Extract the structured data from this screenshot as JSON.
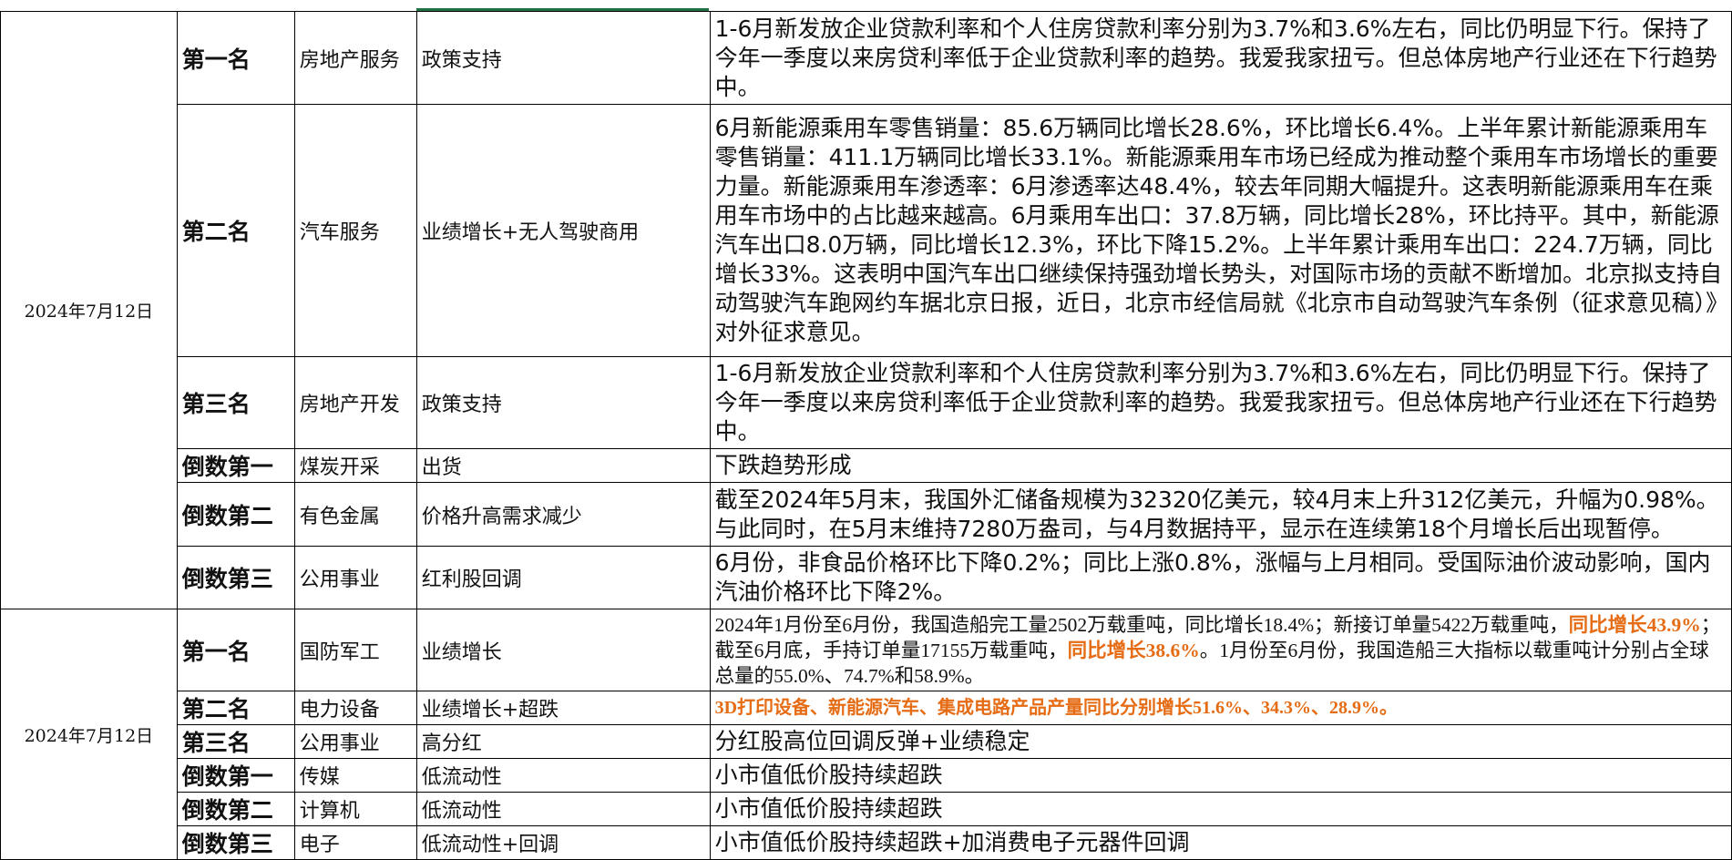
{
  "groups": [
    {
      "date": "2024年7月12日",
      "rows": [
        {
          "rank": "第一名",
          "industry": "房地产服务",
          "reason": "政策支持",
          "detail": "1-6月新发放企业贷款利率和个人住房贷款利率分别为3.7%和3.6%左右，同比仍明显下行。保持了今年一季度以来房贷利率低于企业贷款利率的趋势。我爱我家扭亏。但总体房地产行业还在下行趋势中。"
        },
        {
          "rank": "第二名",
          "industry": "汽车服务",
          "reason": "业绩增长+无人驾驶商用",
          "detail": "6月新能源乘用车零售销量：85.6万辆同比增长28.6%，环比增长6.4%。上半年累计新能源乘用车零售销量：411.1万辆同比增长33.1%。新能源乘用车市场已经成为推动整个乘用车市场增长的重要力量。新能源乘用车渗透率：6月渗透率达48.4%，较去年同期大幅提升。这表明新能源乘用车在乘用车市场中的占比越来越高。6月乘用车出口：37.8万辆，同比增长28%，环比持平。其中，新能源汽车出口8.0万辆，同比增长12.3%，环比下降15.2%。上半年累计乘用车出口：224.7万辆，同比增长33%。这表明中国汽车出口继续保持强劲增长势头，对国际市场的贡献不断增加。北京拟支持自动驾驶汽车跑网约车据北京日报，近日，北京市经信局就《北京市自动驾驶汽车条例（征求意见稿）》对外征求意见。"
        },
        {
          "rank": "第三名",
          "industry": "房地产开发",
          "reason": "政策支持",
          "detail": "1-6月新发放企业贷款利率和个人住房贷款利率分别为3.7%和3.6%左右，同比仍明显下行。保持了今年一季度以来房贷利率低于企业贷款利率的趋势。我爱我家扭亏。但总体房地产行业还在下行趋势中。"
        },
        {
          "rank": "倒数第一",
          "industry": "煤炭开采",
          "reason": "出货",
          "detail": "下跌趋势形成"
        },
        {
          "rank": "倒数第二",
          "industry": "有色金属",
          "reason": "价格升高需求减少",
          "detail": "截至2024年5月末，我国外汇储备规模为32320亿美元，较4月末上升312亿美元，升幅为0.98%。与此同时，在5月末维持7280万盎司，与4月数据持平，显示在连续第18个月增长后出现暂停。"
        },
        {
          "rank": "倒数第三",
          "industry": "公用事业",
          "reason": "红利股回调",
          "detail": "6月份，非食品价格环比下降0.2%；同比上涨0.8%，涨幅与上月相同。受国际油价波动影响，国内汽油价格环比下降2%。"
        }
      ]
    },
    {
      "date": "2024年7月12日",
      "rows": [
        {
          "rank": "第一名",
          "industry": "国防军工",
          "reason": "业绩增长",
          "detail_parts": [
            {
              "text": "2024年1月份至6月份，我国造船完工量2502万载重吨，同比增长18.4%；新接订单量5422万载重吨，",
              "highlight": false
            },
            {
              "text": "同比增长43.9%",
              "highlight": true
            },
            {
              "text": "；截至6月底，手持订单量17155万载重吨，",
              "highlight": false
            },
            {
              "text": "同比增长38.6%",
              "highlight": true
            },
            {
              "text": "。1月份至6月份，我国造船三大指标以载重吨计分别占全球总量的55.0%、74.7%和58.9%。",
              "highlight": false
            }
          ]
        },
        {
          "rank": "第二名",
          "industry": "电力设备",
          "reason": "业绩增长+超跌",
          "detail": "3D打印设备、新能源汽车、集成电路产品产量同比分别增长51.6%、34.3%、28.9%。"
        },
        {
          "rank": "第三名",
          "industry": "公用事业",
          "reason": "高分红",
          "detail": "分红股高位回调反弹+业绩稳定"
        },
        {
          "rank": "倒数第一",
          "industry": "传媒",
          "reason": "低流动性",
          "detail": "小市值低价股持续超跌"
        },
        {
          "rank": "倒数第二",
          "industry": "计算机",
          "reason": "低流动性",
          "detail": "小市值低价股持续超跌"
        },
        {
          "rank": "倒数第三",
          "industry": "电子",
          "reason": "低流动性+回调",
          "detail": "小市值低价股持续超跌+加消费电子元器件回调"
        }
      ]
    }
  ],
  "colors": {
    "border": "#000000",
    "highlight": "#e56c14",
    "active_cell_indicator": "#217346"
  }
}
